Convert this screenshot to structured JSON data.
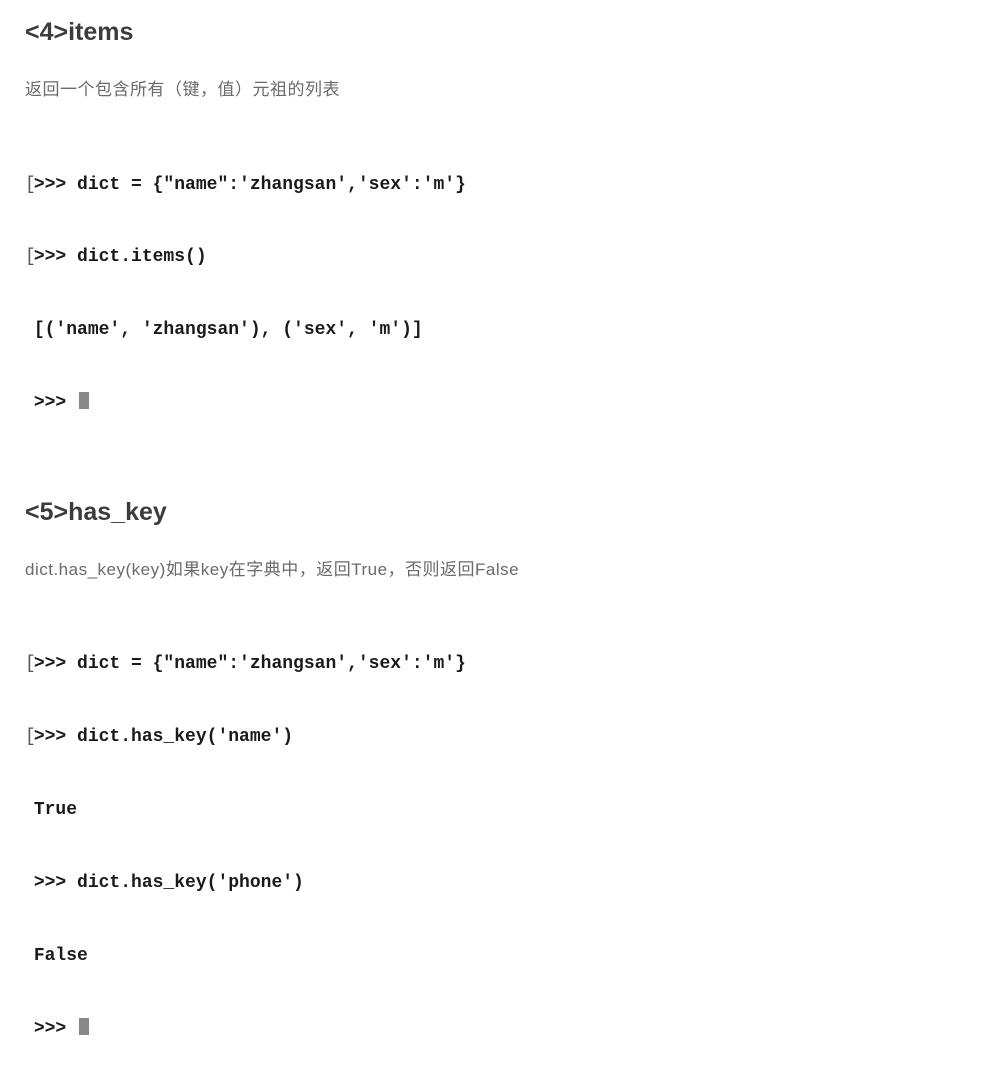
{
  "sections": [
    {
      "heading": "<4>items",
      "description": "返回一个包含所有（键，值）元祖的列表",
      "code_lines": [
        {
          "prefix": "[",
          "text": ">>> dict = {\"name\":'zhangsan','sex':'m'}"
        },
        {
          "prefix": "[",
          "text": ">>> dict.items()"
        },
        {
          "prefix": " ",
          "text": "[('name', 'zhangsan'), ('sex', 'm')]"
        },
        {
          "prefix": " ",
          "text": ">>> ",
          "cursor": true
        }
      ]
    },
    {
      "heading": "<5>has_key",
      "description": "dict.has_key(key)如果key在字典中，返回True，否则返回False",
      "code_lines": [
        {
          "prefix": "[",
          "text": ">>> dict = {\"name\":'zhangsan','sex':'m'}"
        },
        {
          "prefix": "[",
          "text": ">>> dict.has_key('name')"
        },
        {
          "prefix": " ",
          "text": "True"
        },
        {
          "prefix": " ",
          "text": ">>> dict.has_key('phone')"
        },
        {
          "prefix": " ",
          "text": "False"
        },
        {
          "prefix": " ",
          "text": ">>> ",
          "cursor": true
        }
      ]
    }
  ]
}
